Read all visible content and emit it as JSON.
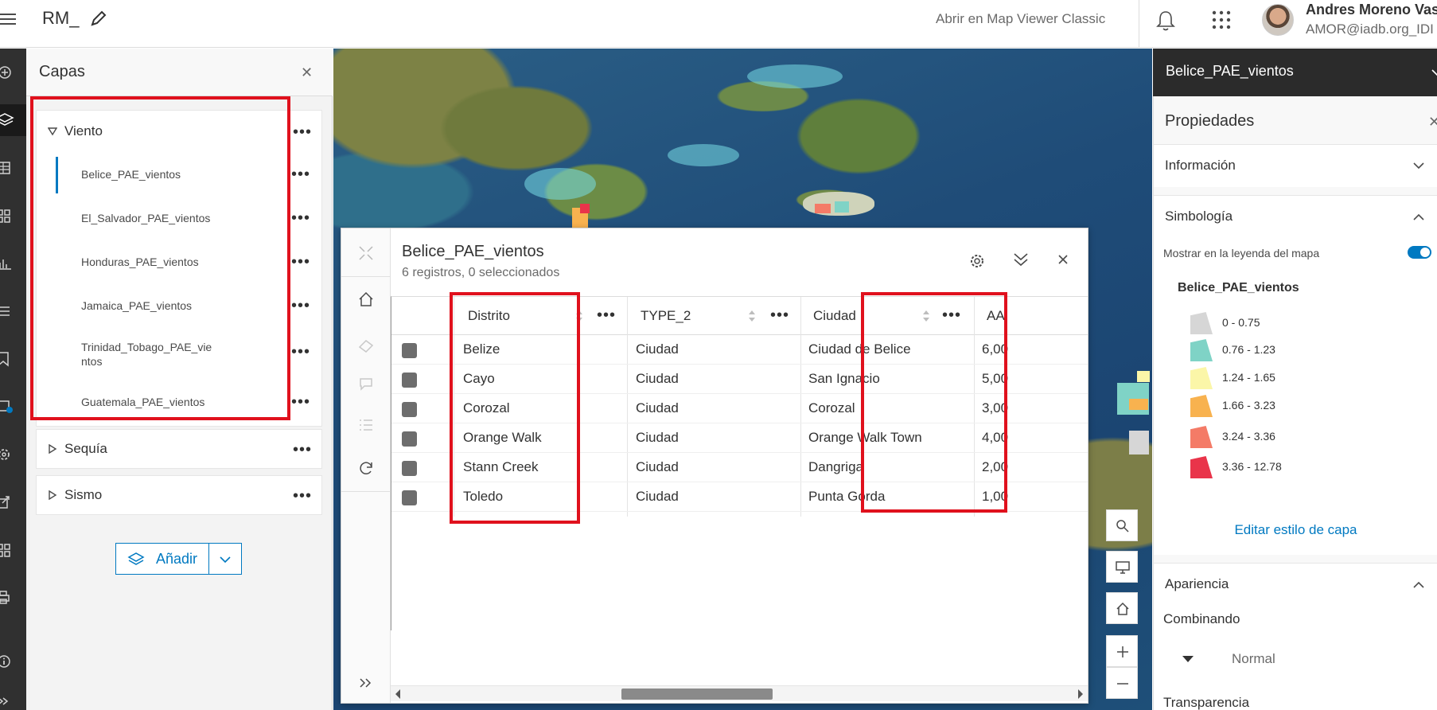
{
  "header": {
    "app_title": "RM_",
    "classic_link": "Abrir en Map Viewer Classic",
    "user_name": "Andres Moreno Vas",
    "user_email": "AMOR@iadb.org_IDI"
  },
  "layers_panel": {
    "title": "Capas",
    "groups": [
      {
        "label": "Viento",
        "expanded": true,
        "layers": [
          {
            "label": "Belice_PAE_vientos",
            "selected": true
          },
          {
            "label": "El_Salvador_PAE_vientos"
          },
          {
            "label": "Honduras_PAE_vientos"
          },
          {
            "label": "Jamaica_PAE_vientos"
          },
          {
            "label": "Trinidad_Tobago_PAE_vie ntos"
          },
          {
            "label": "Guatemala_PAE_vientos"
          }
        ]
      },
      {
        "label": "Sequía",
        "expanded": false
      },
      {
        "label": "Sismo",
        "expanded": false
      }
    ],
    "add_button": "Añadir"
  },
  "table": {
    "title": "Belice_PAE_vientos",
    "subtitle": "6 registros, 0 seleccionados",
    "columns": [
      "Distrito",
      "TYPE_2",
      "Ciudad",
      "AA"
    ],
    "rows": [
      [
        "Belize",
        "Ciudad",
        "Ciudad de Belice",
        "6,00"
      ],
      [
        "Cayo",
        "Ciudad",
        "San Ignacio",
        "5,00"
      ],
      [
        "Corozal",
        "Ciudad",
        "Corozal",
        "3,00"
      ],
      [
        "Orange Walk",
        "Ciudad",
        "Orange Walk Town",
        "4,00"
      ],
      [
        "Stann Creek",
        "Ciudad",
        "Dangriga",
        "2,00"
      ],
      [
        "Toledo",
        "Ciudad",
        "Punta Gorda",
        "1,00"
      ]
    ]
  },
  "right_panel": {
    "header": "Belice_PAE_vientos",
    "title": "Propiedades",
    "sections": {
      "info": "Información",
      "symbology": "Simbología",
      "appearance": "Apariencia"
    },
    "legend_toggle_label": "Mostrar en la leyenda del mapa",
    "legend_toggle_on": true,
    "legend_title": "Belice_PAE_vientos",
    "legend": [
      {
        "label": "0 - 0.75",
        "color": "#d6d6d6"
      },
      {
        "label": "0.76 - 1.23",
        "color": "#7fd3c6"
      },
      {
        "label": "1.24 - 1.65",
        "color": "#fbf6a8"
      },
      {
        "label": "1.66 - 3.23",
        "color": "#f8b24f"
      },
      {
        "label": "3.24 - 3.36",
        "color": "#f47b67"
      },
      {
        "label": "3.36 - 12.78",
        "color": "#e9344a"
      }
    ],
    "edit_style": "Editar estilo de capa",
    "blend_label": "Combinando",
    "blend_value": "Normal",
    "transparency_label": "Transparencia"
  },
  "colors": {
    "accent": "#0079c1",
    "highlight_box": "#e0111d",
    "dark_header": "#2b2b2b"
  }
}
